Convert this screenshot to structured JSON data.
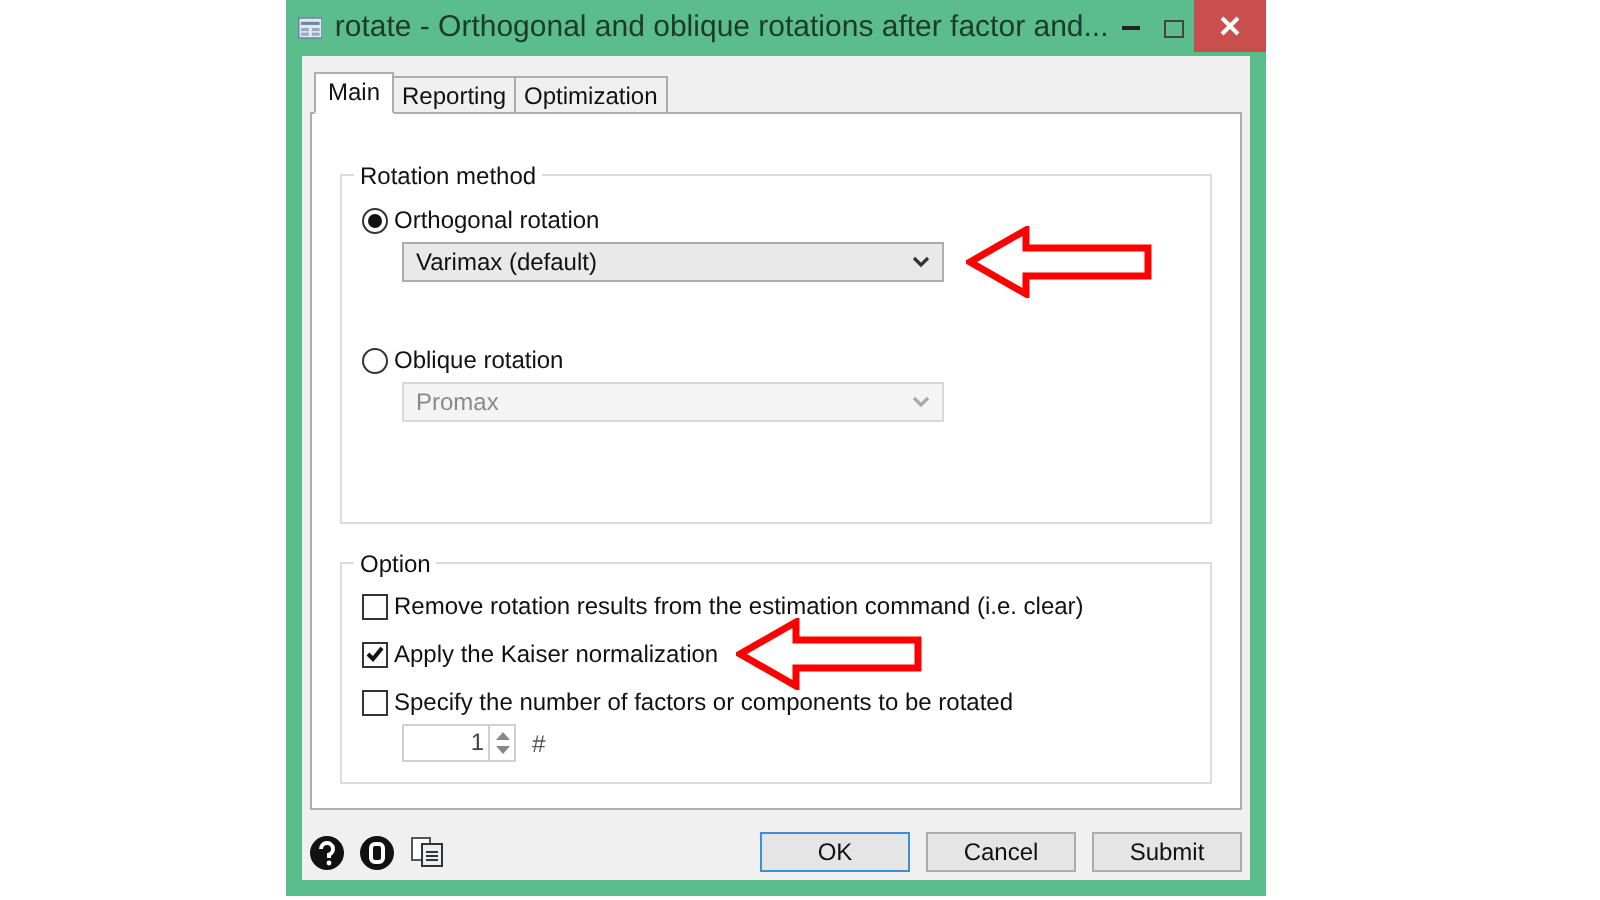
{
  "window": {
    "title": "rotate - Orthogonal and oblique rotations after factor and..."
  },
  "tabs": [
    {
      "label": "Main",
      "selected": true
    },
    {
      "label": "Reporting",
      "selected": false
    },
    {
      "label": "Optimization",
      "selected": false
    }
  ],
  "rotation_method": {
    "title": "Rotation method",
    "options": [
      {
        "label": "Orthogonal rotation",
        "selected": true,
        "dropdown": {
          "value": "Varimax (default)",
          "disabled": false,
          "annotated": true
        }
      },
      {
        "label": "Oblique rotation",
        "selected": false,
        "dropdown": {
          "value": "Promax",
          "disabled": true,
          "annotated": false
        }
      }
    ]
  },
  "option": {
    "title": "Option",
    "checkboxes": [
      {
        "label": "Remove rotation results from the estimation command (i.e. clear)",
        "checked": false,
        "annotated": false
      },
      {
        "label": "Apply the Kaiser normalization",
        "checked": true,
        "annotated": true
      },
      {
        "label": "Specify the number of factors or components to be rotated",
        "checked": false,
        "annotated": false
      }
    ],
    "spinner": {
      "value": "1",
      "suffix": "#"
    }
  },
  "buttons": [
    {
      "label": "OK",
      "default": true
    },
    {
      "label": "Cancel",
      "default": false
    },
    {
      "label": "Submit",
      "default": false
    }
  ]
}
